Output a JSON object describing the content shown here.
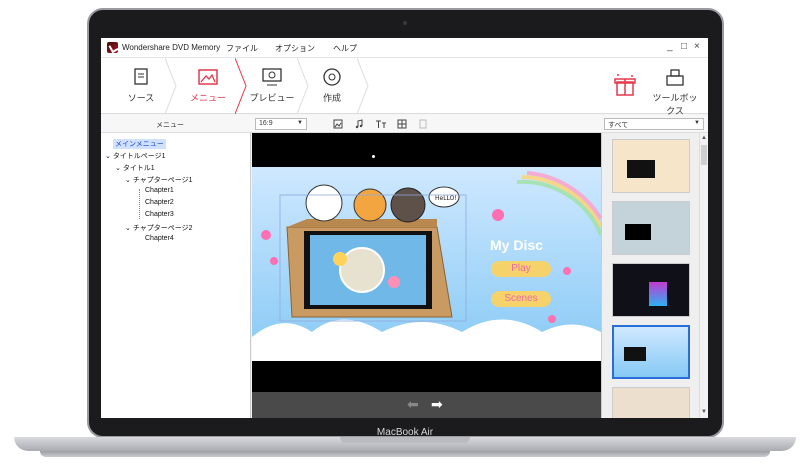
{
  "app": {
    "title": "Wondershare DVD Memory",
    "menu": [
      "ファイル",
      "オプション",
      "ヘルプ"
    ],
    "window_controls": [
      "_",
      "□",
      "×"
    ]
  },
  "steps": [
    {
      "label": "ソース",
      "icon": "document-icon",
      "active": false
    },
    {
      "label": "メニュー",
      "icon": "menu-image-icon",
      "active": true
    },
    {
      "label": "プレビュー",
      "icon": "preview-play-icon",
      "active": false
    },
    {
      "label": "作成",
      "icon": "disc-burn-icon",
      "active": false
    }
  ],
  "toolbox": {
    "label": "ツールボックス"
  },
  "subbar": {
    "left_label": "メニュー",
    "aspect_ratio": "16:9",
    "filter": "すべて"
  },
  "tree": [
    {
      "label": "メインメニュー",
      "selected": true
    },
    {
      "label": "タイトルページ1",
      "selected": false
    },
    {
      "label": "タイトル1",
      "selected": false
    },
    {
      "label": "チャプターページ1",
      "selected": false
    },
    {
      "label": "Chapter1",
      "selected": false
    },
    {
      "label": "Chapter2",
      "selected": false
    },
    {
      "label": "Chapter3",
      "selected": false
    },
    {
      "label": "チャプターページ2",
      "selected": false
    },
    {
      "label": "Chapter4",
      "selected": false
    }
  ],
  "menu_preview": {
    "disc_title": "My Disc",
    "buttons": [
      "Play",
      "Scenes"
    ],
    "sign_text": "HeLLO!"
  },
  "device": {
    "label": "MacBook Air"
  },
  "colors": {
    "accent": "#e23a4e",
    "button_fill": "#f6d36a",
    "button_text": "#ee6aa6"
  }
}
